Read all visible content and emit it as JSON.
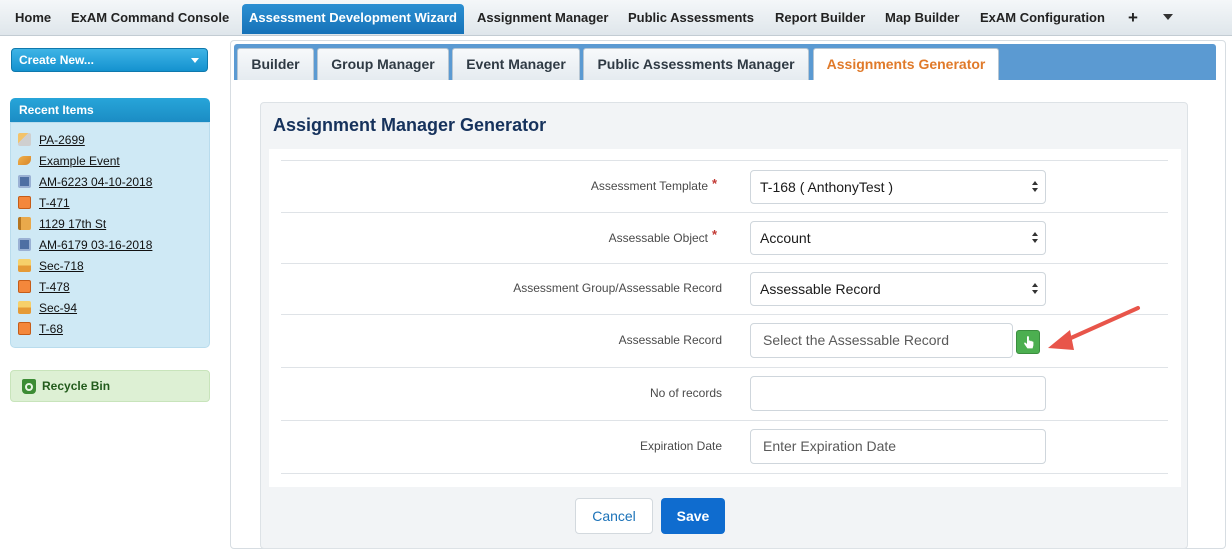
{
  "topnav": {
    "tabs": [
      "Home",
      "ExAM Command Console",
      "Assessment Development Wizard",
      "Assignment Manager",
      "Public Assessments",
      "Report Builder",
      "Map Builder",
      "ExAM Configuration"
    ],
    "active_tab": "Assessment Development Wizard",
    "plus_label": "+"
  },
  "sidebar": {
    "create_label": "Create New...",
    "recent_title": "Recent Items",
    "recent_items": [
      "PA-2699",
      "Example Event",
      "AM-6223 04-10-2018",
      "T-471",
      "1129 17th St",
      "AM-6179 03-16-2018",
      "Sec-718",
      "T-478",
      "Sec-94",
      "T-68"
    ],
    "recycle_label": "Recycle Bin"
  },
  "subtabs": [
    "Builder",
    "Group Manager",
    "Event Manager",
    "Public Assessments Manager",
    "Assignments Generator"
  ],
  "active_subtab": "Assignments Generator",
  "form": {
    "title": "Assignment Manager Generator",
    "required_mark": "*",
    "fields": {
      "template_label": "Assessment Template",
      "template_value": "T-168 ( AnthonyTest )",
      "object_label": "Assessable Object",
      "object_value": "Account",
      "group_label": "Assessment Group/Assessable Record",
      "group_value": "Assessable Record",
      "record_label": "Assessable Record",
      "record_placeholder": "Select the Assessable Record",
      "count_label": "No of records",
      "count_value": "",
      "expiration_label": "Expiration Date",
      "expiration_placeholder": "Enter Expiration Date"
    },
    "cancel_label": "Cancel",
    "save_label": "Save"
  },
  "colors": {
    "accent_blue": "#1672b8",
    "active_subtab_text": "#e07a2a",
    "save_button": "#0f6ccf",
    "picker_green": "#4caf50",
    "annotation_arrow": "#e8554a"
  }
}
